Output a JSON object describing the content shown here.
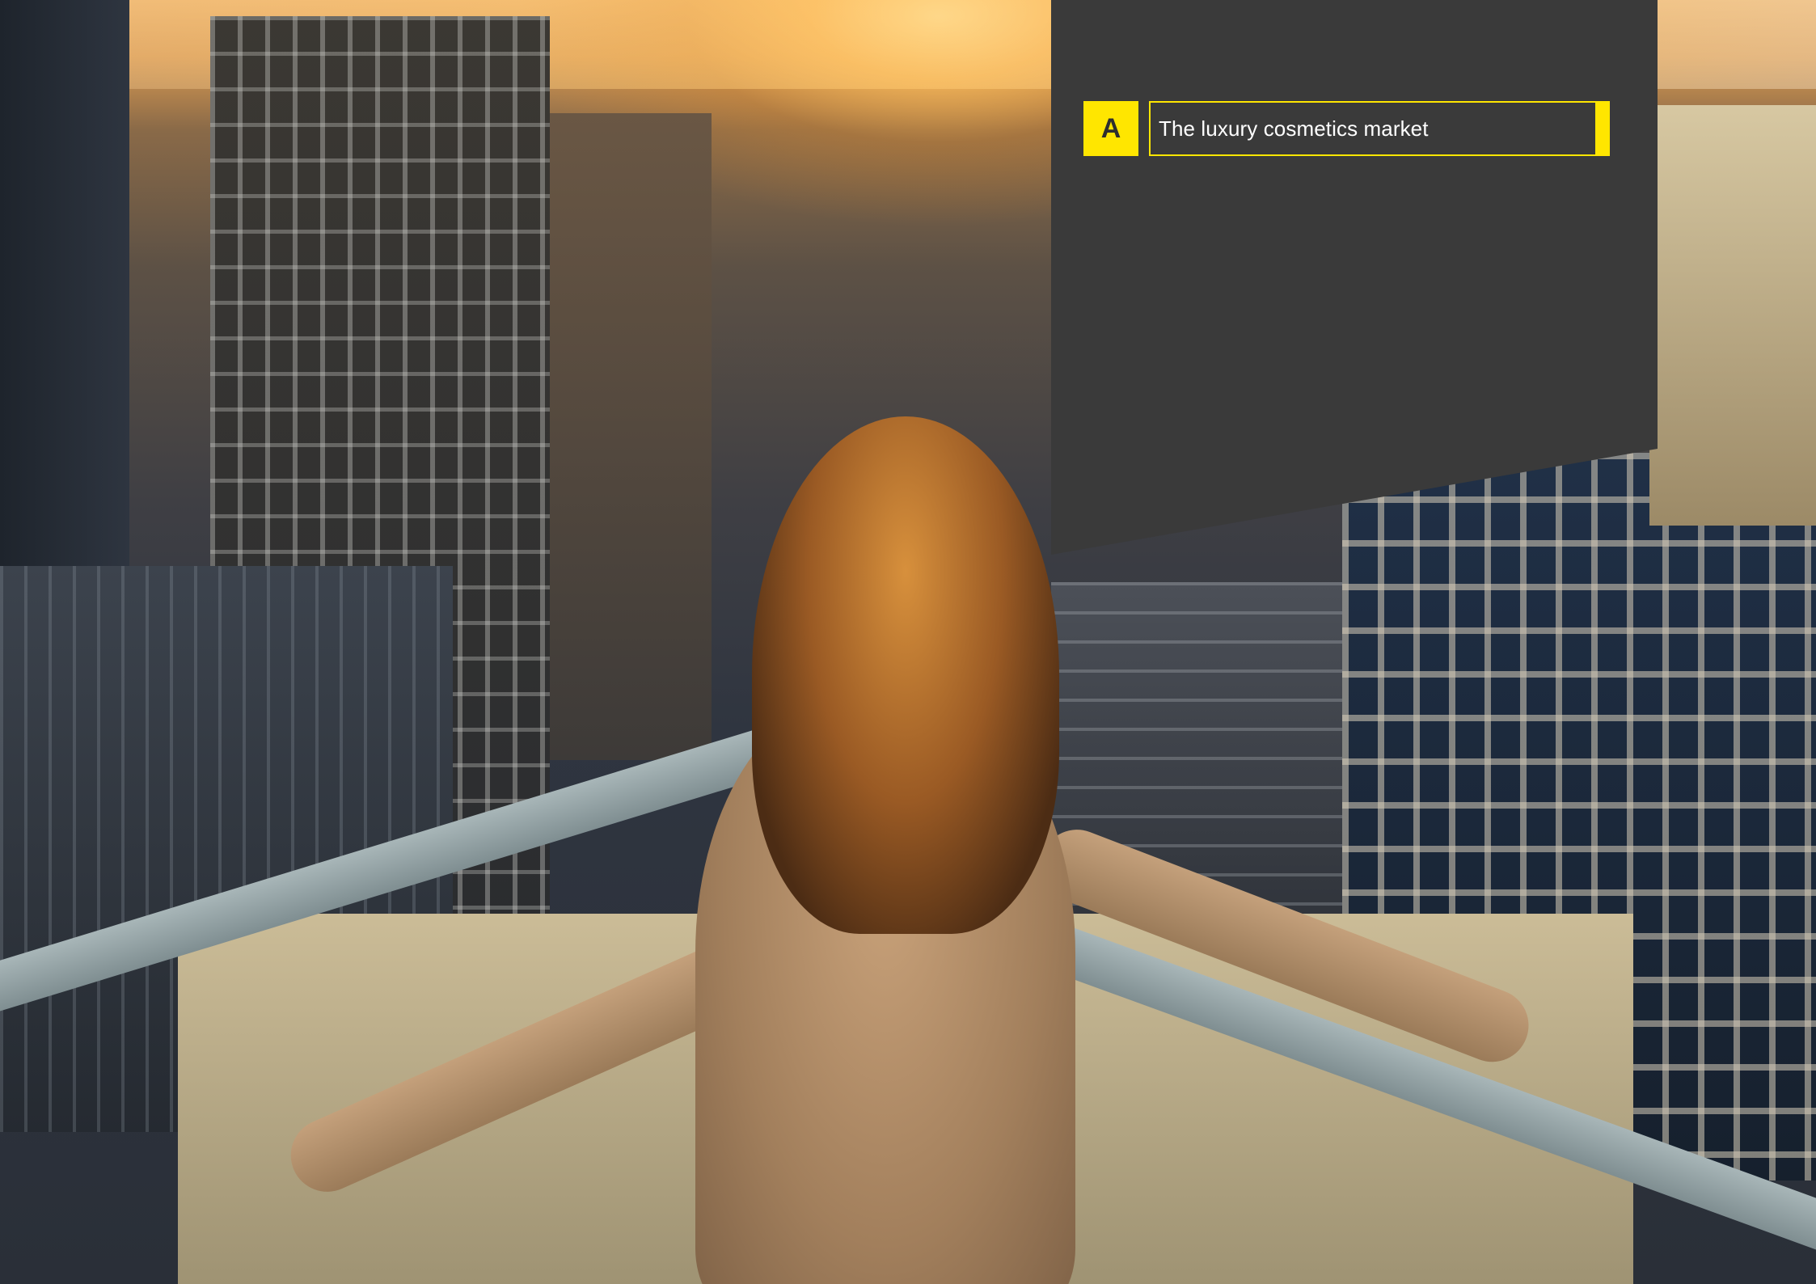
{
  "section": {
    "letter": "A",
    "title": "The luxury cosmetics market"
  },
  "colors": {
    "accent": "#ffe600",
    "panel": "#3a3a3a",
    "text": "#ffffff"
  },
  "background": {
    "description_icon": "city-balcony-photo"
  }
}
